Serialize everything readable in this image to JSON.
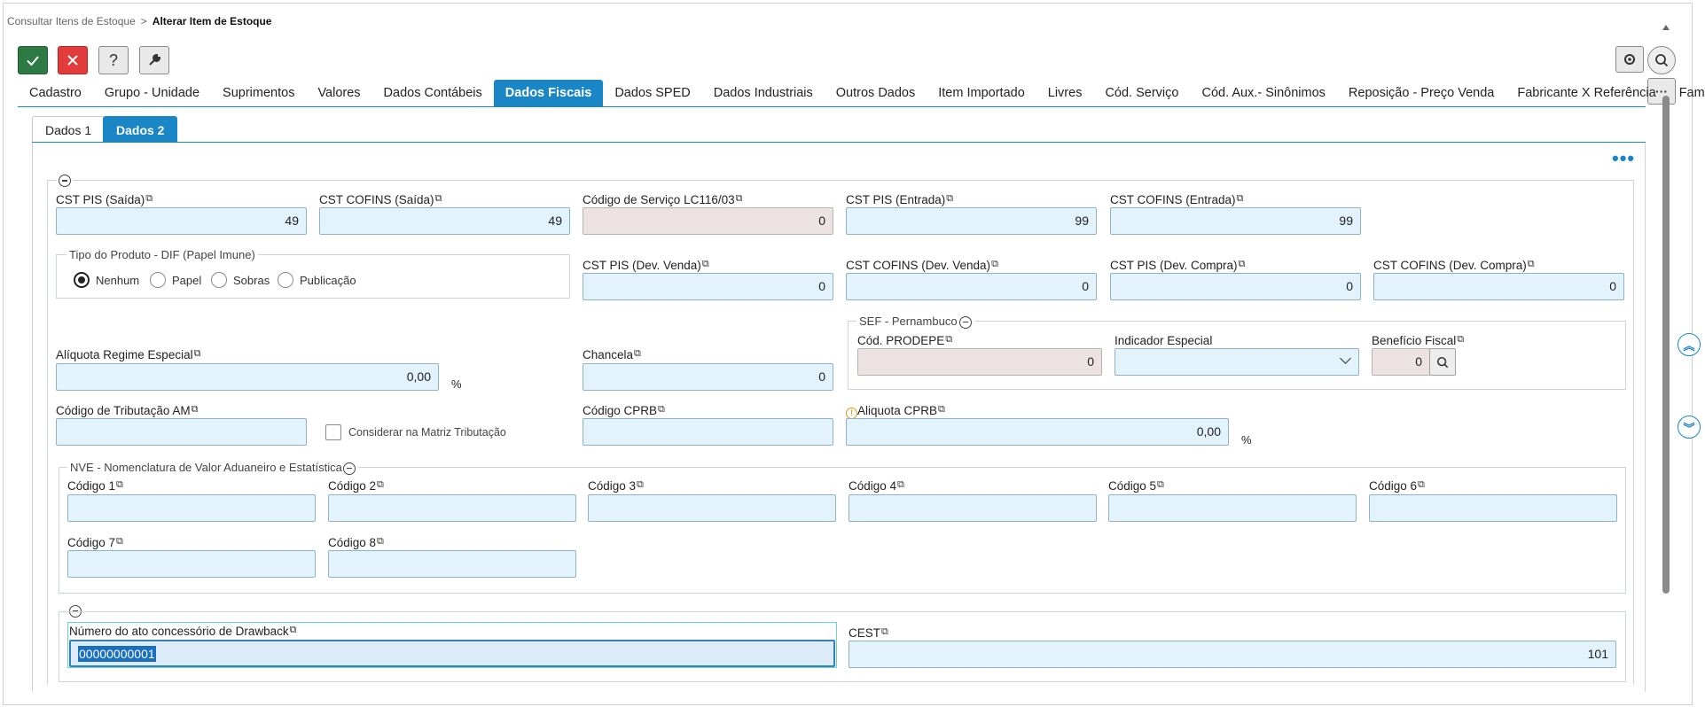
{
  "breadcrumb": {
    "parent": "Consultar Itens de Estoque",
    "separator": ">",
    "current": "Alterar Item de Estoque"
  },
  "toolbar": {
    "confirm_icon": "check-icon",
    "cancel_icon": "close-icon",
    "help_label": "?",
    "tools_icon": "wrench-icon",
    "settings_icon": "gear-icon",
    "search_icon": "search-icon",
    "more_label": "···"
  },
  "tabs": [
    {
      "label": "Cadastro"
    },
    {
      "label": "Grupo - Unidade"
    },
    {
      "label": "Suprimentos"
    },
    {
      "label": "Valores"
    },
    {
      "label": "Dados Contábeis"
    },
    {
      "label": "Dados Fiscais"
    },
    {
      "label": "Dados SPED"
    },
    {
      "label": "Dados Industriais"
    },
    {
      "label": "Outros Dados"
    },
    {
      "label": "Item Importado"
    },
    {
      "label": "Livres"
    },
    {
      "label": "Cód. Serviço"
    },
    {
      "label": "Cód. Aux.- Sinônimos"
    },
    {
      "label": "Reposição - Preço Venda"
    },
    {
      "label": "Fabricante X Referência"
    },
    {
      "label": "Família/Atri"
    }
  ],
  "subtabs": [
    {
      "label": "Dados 1"
    },
    {
      "label": "Dados 2"
    }
  ],
  "more_dots": "•••",
  "fields": {
    "cst_pis_saida": {
      "label": "CST PIS (Saída)",
      "value": "49"
    },
    "cst_cofins_saida": {
      "label": "CST COFINS (Saída)",
      "value": "49"
    },
    "codigo_servico": {
      "label": "Código de Serviço LC116/03",
      "value": "0"
    },
    "cst_pis_entrada": {
      "label": "CST PIS (Entrada)",
      "value": "99"
    },
    "cst_cofins_entrada": {
      "label": "CST COFINS (Entrada)",
      "value": "99"
    },
    "cst_pis_dev_venda": {
      "label": "CST PIS (Dev. Venda)",
      "value": "0"
    },
    "cst_cofins_dev_venda": {
      "label": "CST COFINS (Dev. Venda)",
      "value": "0"
    },
    "cst_pis_dev_compra": {
      "label": "CST PIS (Dev. Compra)",
      "value": "0"
    },
    "cst_cofins_dev_compra": {
      "label": "CST COFINS (Dev. Compra)",
      "value": "0"
    },
    "aliquota_regime": {
      "label": "Alíquota Regime Especial",
      "value": "0,00",
      "unit": "%"
    },
    "chancela": {
      "label": "Chancela",
      "value": "0"
    },
    "codigo_trib_am": {
      "label": "Código de Tributação AM",
      "value": ""
    },
    "considerar_matriz": {
      "label": "Considerar na Matriz Tributação",
      "checked": false
    },
    "codigo_cprb": {
      "label": "Código CPRB",
      "value": ""
    },
    "aliquota_cprb": {
      "label": "Aliquota CPRB",
      "value": "0,00",
      "unit": "%",
      "warn_icon": "info-warning-icon"
    },
    "drawback": {
      "label": "Número do ato concessório de Drawback",
      "value": "00000000001"
    },
    "cest": {
      "label": "CEST",
      "value": "101"
    }
  },
  "tipo_produto": {
    "legend": "Tipo do Produto - DIF (Papel Imune)",
    "options": [
      {
        "label": "Nenhum",
        "selected": true
      },
      {
        "label": "Papel",
        "selected": false
      },
      {
        "label": "Sobras",
        "selected": false
      },
      {
        "label": "Publicação",
        "selected": false
      }
    ]
  },
  "sef": {
    "legend": "SEF - Pernambuco",
    "cod_prodepe": {
      "label": "Cód. PRODEPE",
      "value": "0"
    },
    "indicador_especial": {
      "label": "Indicador Especial",
      "value": ""
    },
    "beneficio_fiscal": {
      "label": "Benefício Fiscal",
      "value": "0"
    }
  },
  "nve": {
    "legend": "NVE - Nomenclatura de Valor Aduaneiro e Estatística",
    "codes": [
      {
        "label": "Código 1",
        "value": ""
      },
      {
        "label": "Código 2",
        "value": ""
      },
      {
        "label": "Código 3",
        "value": ""
      },
      {
        "label": "Código 4",
        "value": ""
      },
      {
        "label": "Código 5",
        "value": ""
      },
      {
        "label": "Código 6",
        "value": ""
      },
      {
        "label": "Código 7",
        "value": ""
      },
      {
        "label": "Código 8",
        "value": ""
      }
    ]
  },
  "copy_icon": "⧉"
}
